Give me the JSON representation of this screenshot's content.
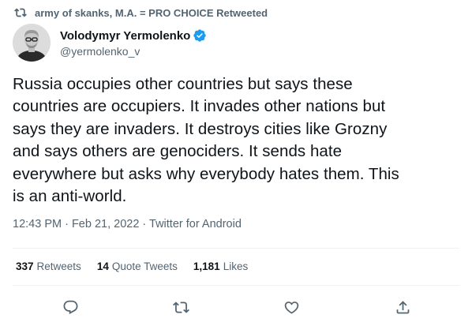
{
  "retweet_header": {
    "text": "army of skanks, M.A. = PRO CHOICE Retweeted",
    "icon": "retweet-icon"
  },
  "author": {
    "name": "Volodymyr Yermolenko",
    "handle": "@yermolenko_v",
    "verified": true,
    "verified_color": "#1d9bf0"
  },
  "tweet": {
    "text": "Russia occupies other countries but says these\ncountries are occupiers. It invades other nations but\nsays they are invaders. It destroys cities like Grozny\nand says others are genociders. It sends hate\neverywhere but asks why everybody hates them. This\nis an anti-world.",
    "meta": "12:43 PM · Feb 21, 2022 · Twitter for Android"
  },
  "stats": {
    "retweets": {
      "count": "337",
      "label": "Retweets"
    },
    "quote_tweets": {
      "count": "14",
      "label": "Quote Tweets"
    },
    "likes": {
      "count": "1,181",
      "label": "Likes"
    }
  },
  "actions": {
    "reply_icon": "reply-icon",
    "retweet_icon": "retweet-icon",
    "like_icon": "heart-icon",
    "share_icon": "share-icon"
  },
  "colors": {
    "text_primary": "#0f1419",
    "text_secondary": "#536471",
    "divider": "#eff3f4",
    "accent": "#1d9bf0"
  }
}
